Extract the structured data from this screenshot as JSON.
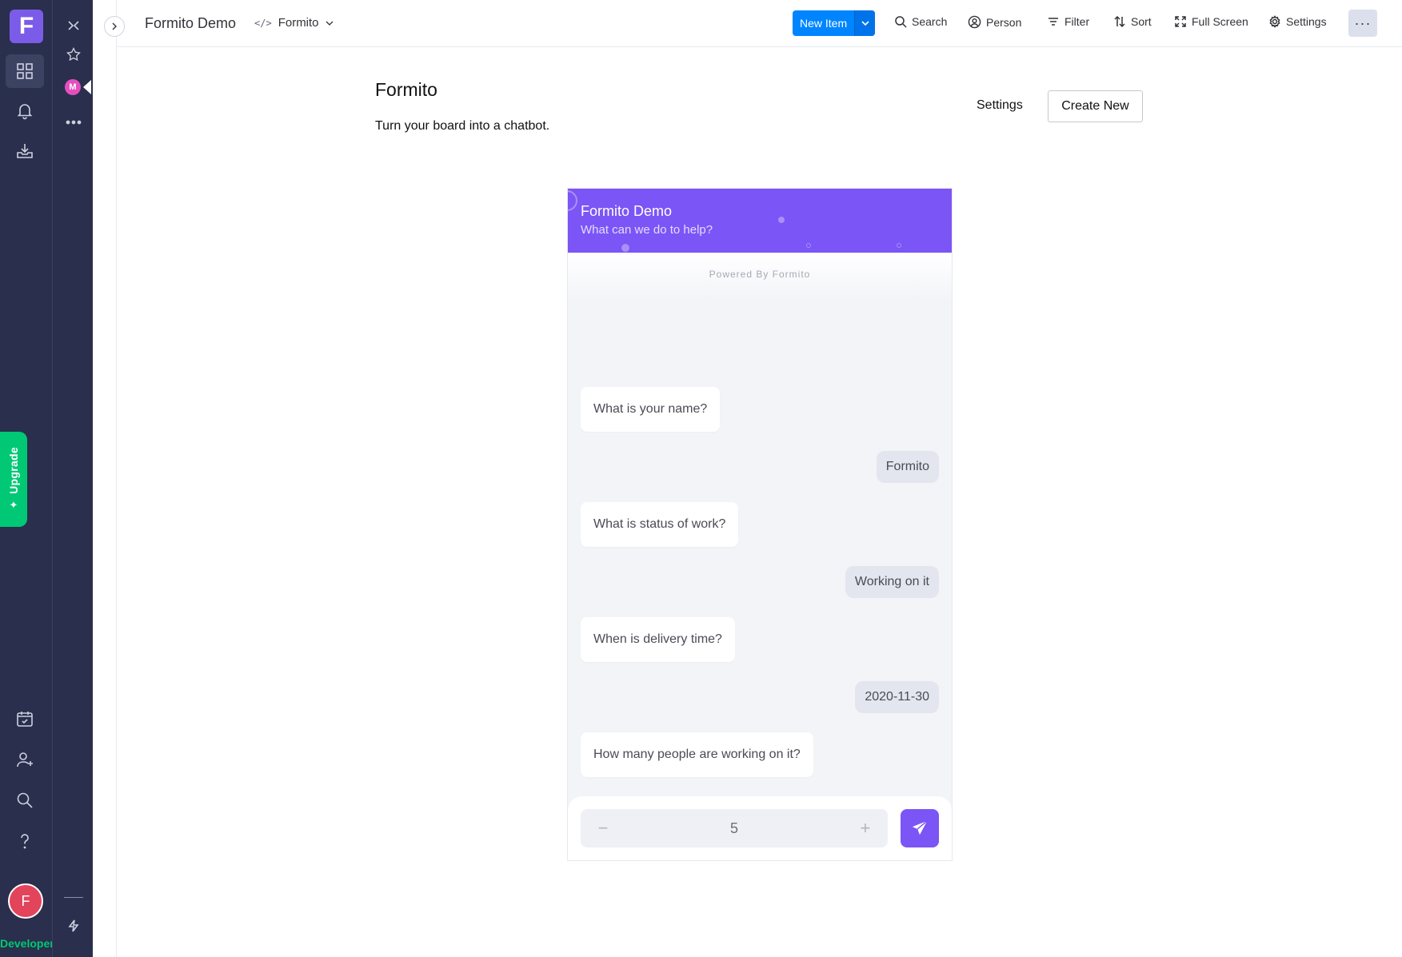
{
  "app": {
    "logo_letter": "F",
    "brand_color": "#7b5ce8",
    "accent_color": "#0073ea"
  },
  "rail": {
    "items": [
      "workspace-icon",
      "bell-icon",
      "inbox-download-icon"
    ],
    "bottom_items": [
      "calendar-check-icon",
      "invite-user-icon",
      "search-icon",
      "help-icon"
    ],
    "upgrade_label": "Upgrade",
    "avatar_letter": "F",
    "plan_label": "Developer"
  },
  "rail2": {
    "badge_letter": "M"
  },
  "header": {
    "board_title": "Formito Demo",
    "view_label": "Formito",
    "new_item_label": "New Item",
    "tools": {
      "search": "Search",
      "person": "Person",
      "filter": "Filter",
      "sort": "Sort",
      "fullscreen": "Full Screen",
      "settings": "Settings"
    },
    "more_label": "···"
  },
  "page": {
    "title": "Formito",
    "subtitle": "Turn your board into a chatbot.",
    "settings_label": "Settings",
    "create_label": "Create New"
  },
  "chat": {
    "title": "Formito Demo",
    "subtitle": "What can we do to help?",
    "powered": "Powered By Formito",
    "header_color": "#7b55f6",
    "messages": [
      {
        "from": "bot",
        "text": "What is your name?"
      },
      {
        "from": "user",
        "text": "Formito"
      },
      {
        "from": "bot",
        "text": "What is status of work?"
      },
      {
        "from": "user",
        "text": "Working on it"
      },
      {
        "from": "bot",
        "text": "When is delivery time?"
      },
      {
        "from": "user",
        "text": "2020-11-30"
      },
      {
        "from": "bot",
        "text": "How many people are working on it?"
      }
    ],
    "stepper": {
      "minus": "−",
      "value": "5",
      "plus": "+"
    }
  }
}
